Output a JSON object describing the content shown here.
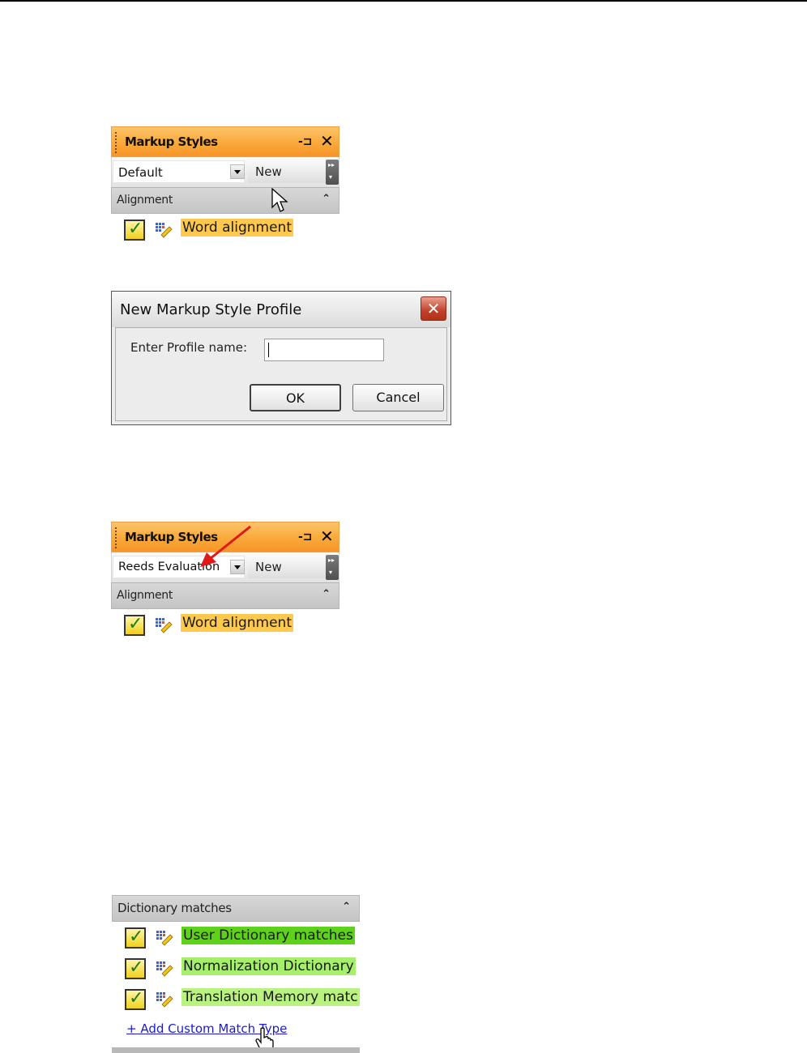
{
  "panel1": {
    "title": "Markup Styles",
    "profile_value": "Default",
    "new_label": "New",
    "group": "Alignment",
    "items": [
      {
        "label": "Word alignment",
        "color": "#ffc94d"
      }
    ]
  },
  "dialog": {
    "title": "New Markup Style Profile",
    "field_label": "Enter Profile name:",
    "field_value": "",
    "ok_label": "OK",
    "cancel_label": "Cancel"
  },
  "panel2": {
    "title": "Markup Styles",
    "profile_value": "Reeds Evaluation",
    "new_label": "New",
    "group": "Alignment",
    "items": [
      {
        "label": "Word alignment",
        "color": "#ffc94d"
      }
    ]
  },
  "dictionary": {
    "group": "Dictionary matches",
    "items": [
      {
        "label": "User Dictionary matches",
        "color": "#5ed11a"
      },
      {
        "label": "Normalization Dictionary",
        "color": "#a6ef6a"
      },
      {
        "label": "Translation Memory matc",
        "color": "#b9f27e"
      }
    ],
    "add_link": "+ Add Custom Match Type"
  },
  "icons": {
    "pin": "pin-icon",
    "close": "close-icon",
    "dropdown": "chevron-down-icon",
    "collapse": "double-chevron-up-icon",
    "checkbox": "checkbox-icon",
    "edit": "edit-style-icon",
    "cursor_arrow": "arrow-cursor-icon",
    "cursor_hand": "hand-cursor-icon",
    "annotation": "red-arrow-icon"
  }
}
